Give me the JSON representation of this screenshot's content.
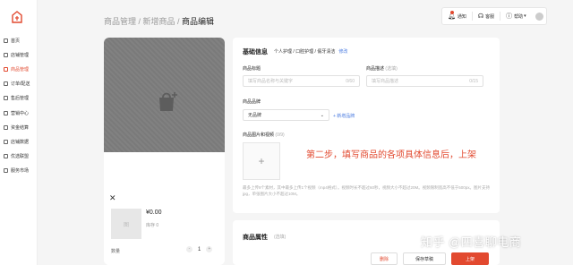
{
  "sidebar": {
    "items": [
      {
        "label": "首页",
        "icon": "home-icon"
      },
      {
        "label": "店铺管理",
        "icon": "store-icon"
      },
      {
        "label": "商品管理",
        "icon": "goods-icon",
        "active": true
      },
      {
        "label": "订单/配送",
        "icon": "order-icon"
      },
      {
        "label": "售后管理",
        "icon": "aftersale-icon"
      },
      {
        "label": "营销中心",
        "icon": "marketing-icon"
      },
      {
        "label": "资金结算",
        "icon": "funds-icon"
      },
      {
        "label": "店铺数据",
        "icon": "data-icon"
      },
      {
        "label": "优选联盟",
        "icon": "alliance-icon"
      },
      {
        "label": "服务市场",
        "icon": "market-icon"
      }
    ]
  },
  "breadcrumb": {
    "part1": "商品管理 / ",
    "part2": "新增商品 / ",
    "current": "商品编辑"
  },
  "toolbar": {
    "notify": "通知",
    "service": "客服",
    "help": "帮助"
  },
  "preview": {
    "price": "¥0.00",
    "stock": "库存 0",
    "qty_label": "数量",
    "qty_value": "1",
    "minus": "-",
    "plus": "+",
    "close": "✕",
    "thumb_text": "图"
  },
  "form": {
    "section_title": "基础信息",
    "category": "个人护理 / 口腔护理 / 假牙清洁",
    "edit_link": "修改",
    "title_label": "商品标题",
    "title_placeholder": "填写商品名称与关键字",
    "title_count": "0/60",
    "desc_label": "商品描述",
    "desc_optional": "(选填)",
    "desc_placeholder": "填写商品描述",
    "desc_count": "0/15",
    "brand_label": "商品品牌",
    "brand_value": "无品牌",
    "new_brand": "+ 新增品牌",
    "media_label": "商品图片和视频",
    "media_count": "(0/9)",
    "instruction": "第二步，填写商品的各项具体信息后，上架",
    "hint": "最多上传9个素材，其中最多上传1个视频（mp4格式）。视频时长不超过60秒，视频大小不超过20M。视频限制宽高不低于500px。图片支持jpg，单张图片大小不超过10M。"
  },
  "section2": {
    "title": "商品属性",
    "optional": "(选填)"
  },
  "buttons": {
    "delete": "删除",
    "draft": "保存草稿",
    "publish": "上架"
  },
  "watermark": "知乎 @四喜聊电商",
  "colors": {
    "accent": "#e2492f",
    "link": "#4a7be0"
  }
}
